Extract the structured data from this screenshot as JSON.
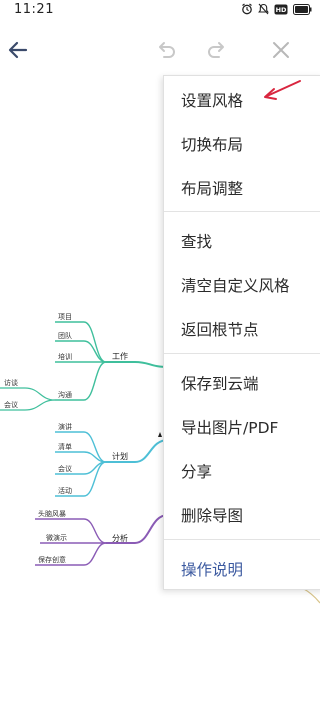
{
  "status_bar": {
    "time": "11:21"
  },
  "menu": {
    "items": [
      "设置风格",
      "切换布局",
      "布局调整",
      "查找",
      "清空自定义风格",
      "返回根节点",
      "保存到云端",
      "导出图片/PDF",
      "分享",
      "删除导图",
      "操作说明"
    ]
  },
  "mindmap": {
    "branches": [
      {
        "label": "工作",
        "color": "#3fbf9c",
        "children": [
          "项目",
          "团队",
          "培训",
          "沟通"
        ],
        "grandchildren": [
          "访谈",
          "会议"
        ]
      },
      {
        "label": "计划",
        "color": "#4dbfd6",
        "children": [
          "演讲",
          "清单",
          "会议",
          "活动"
        ]
      },
      {
        "label": "分析",
        "color": "#8a5bb5",
        "children": [
          "头脑风暴",
          "微演示",
          "保存创意"
        ]
      }
    ]
  },
  "colors": {
    "annotation_arrow": "#d9263f",
    "help_text": "#3c5aa0"
  }
}
